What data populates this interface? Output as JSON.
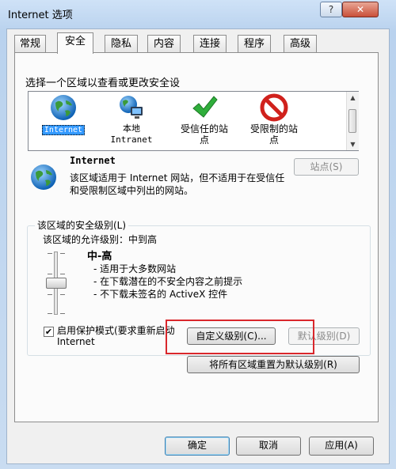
{
  "window": {
    "title": "Internet 选项",
    "help_label": "?",
    "close_label": "✕"
  },
  "tabs": [
    "常规",
    "安全",
    "隐私",
    "内容",
    "连接",
    "程序",
    "高级"
  ],
  "active_tab": "安全",
  "security": {
    "zone_prompt": "选择一个区域以查看或更改安全设",
    "zones": [
      {
        "label": "Internet",
        "icon": "globe-icon"
      },
      {
        "label": "本地\nIntranet",
        "icon": "intranet-icon"
      },
      {
        "label": "受信任的站\n点",
        "icon": "checkmark-icon"
      },
      {
        "label": "受限制的站\n点",
        "icon": "restricted-icon"
      }
    ],
    "selected_zone": "Internet",
    "zone_title": "Internet",
    "zone_description": "该区域适用于 Internet 网站，但不适用于在受信任和受限制区域中列出的网站。",
    "sites_button": "站点(S)",
    "level_group_label": "该区域的安全级别(L)",
    "allowed_levels": "该区域的允许级别：中到高",
    "level_name": "中-高",
    "level_bullets": [
      "- 适用于大多数网站",
      "- 在下载潜在的不安全内容之前提示",
      "- 不下载未签名的 ActiveX 控件"
    ],
    "slider_level": 0.5,
    "protected_mode_label": "启用保护模式(要求重新启动 Internet",
    "protected_mode_checked": true,
    "custom_level_button": "自定义级别(C)...",
    "default_level_button": "默认级别(D)",
    "reset_all_button": "将所有区域重置为默认级别(R)"
  },
  "footer": {
    "ok": "确定",
    "cancel": "取消",
    "apply": "应用(A)"
  },
  "colors": {
    "highlight_box": "#d9272c",
    "selected_zone_bg": "#3399ff"
  }
}
